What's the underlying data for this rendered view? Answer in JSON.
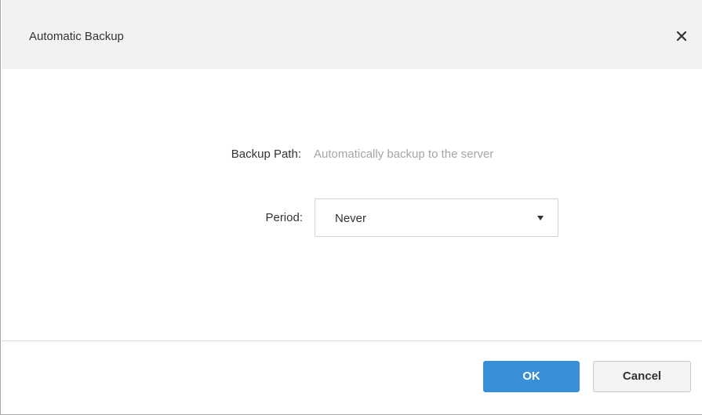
{
  "dialog": {
    "title": "Automatic Backup",
    "close_icon": "close-icon"
  },
  "form": {
    "backup_path_label": "Backup Path:",
    "backup_path_value": "Automatically backup to the server",
    "period_label": "Period:",
    "period_value": "Never",
    "period_icon": "chevron-down-icon"
  },
  "footer": {
    "ok_label": "OK",
    "cancel_label": "Cancel"
  },
  "colors": {
    "primary_button": "#3a8fd9",
    "title_bar": "#f2f2f2",
    "muted_text": "#a6a6a6"
  }
}
